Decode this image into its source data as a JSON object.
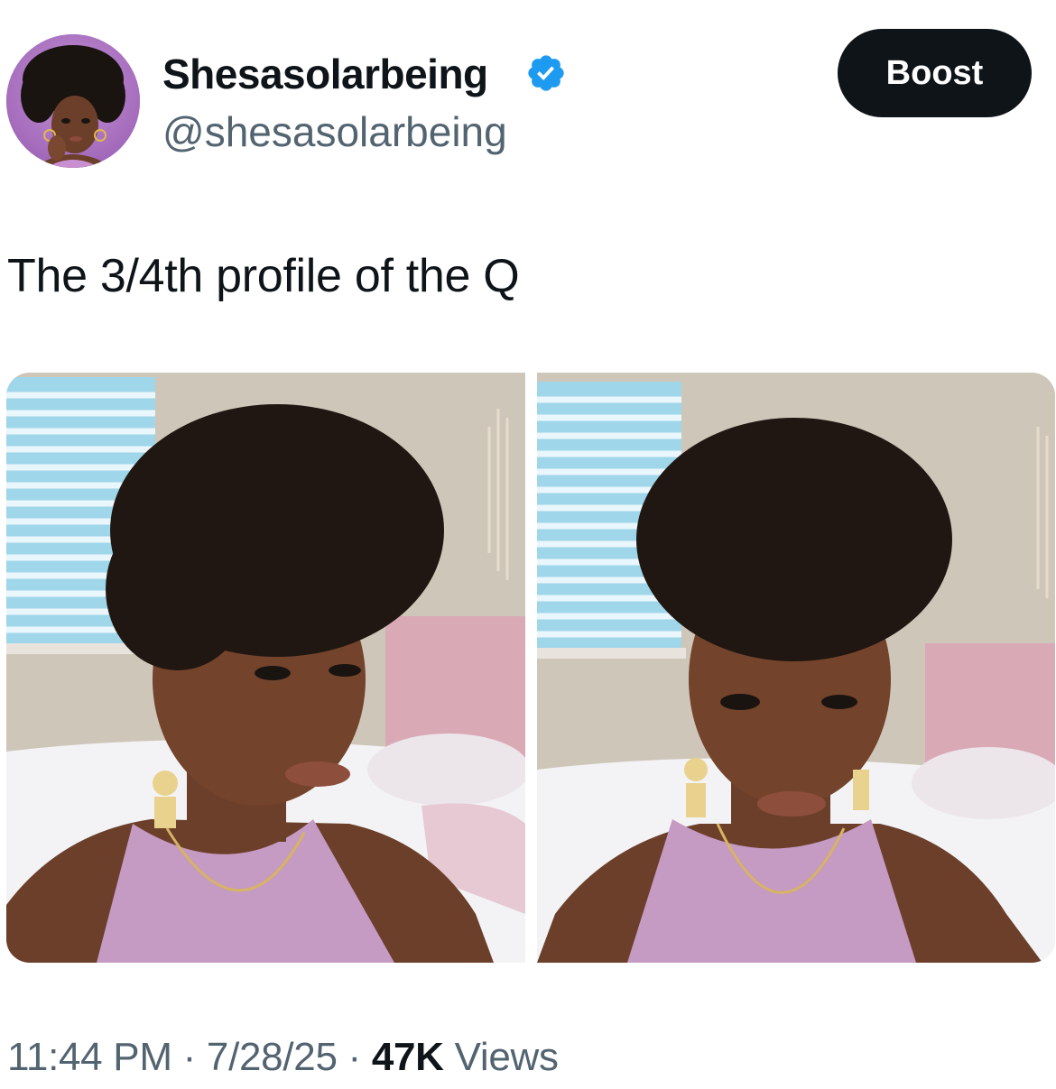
{
  "author": {
    "display_name": "Shesasolarbeing",
    "handle": "@shesasolarbeing",
    "verified_color": "#1d9bf0"
  },
  "actions": {
    "boost_label": "Boost"
  },
  "tweet": {
    "text": "The 3/4th profile of the Q"
  },
  "meta": {
    "time": "11:44 PM",
    "separator": "·",
    "date": "7/28/25",
    "views_count": "47K",
    "views_label": "Views"
  },
  "icons": {
    "verified": "verified-badge-icon"
  },
  "colors": {
    "text": "#0f1419",
    "secondary": "#536471",
    "button_bg": "#0f1419",
    "verified": "#1d9bf0"
  }
}
